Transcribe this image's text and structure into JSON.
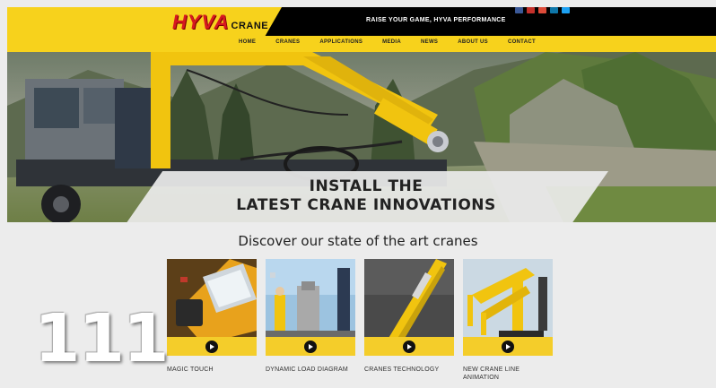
{
  "header": {
    "logo_main": "HYVA",
    "logo_sub": "CRANE",
    "tagline": "RAISE YOUR GAME, HYVA PERFORMANCE",
    "social_colors": [
      "#3b5998",
      "#c4302b",
      "#dd4b39",
      "#0e76a8",
      "#1da1f2"
    ]
  },
  "nav": {
    "items": [
      "HOME",
      "CRANES",
      "APPLICATIONS",
      "MEDIA",
      "NEWS",
      "ABOUT US",
      "CONTACT"
    ]
  },
  "hero": {
    "title_line1": "INSTALL THE",
    "title_line2": "LATEST CRANE INNOVATIONS"
  },
  "section": {
    "title": "Discover our state of the art cranes"
  },
  "cards": [
    {
      "caption": "MAGIC TOUCH"
    },
    {
      "caption": "DYNAMIC LOAD DIAGRAM"
    },
    {
      "caption": "CRANES TECHNOLOGY"
    },
    {
      "caption": "NEW CRANE LINE ANIMATION"
    }
  ],
  "overlay": {
    "number": "111"
  },
  "colors": {
    "brand_yellow": "#f7d21c",
    "brand_red": "#d71920",
    "header_black": "#000000"
  }
}
